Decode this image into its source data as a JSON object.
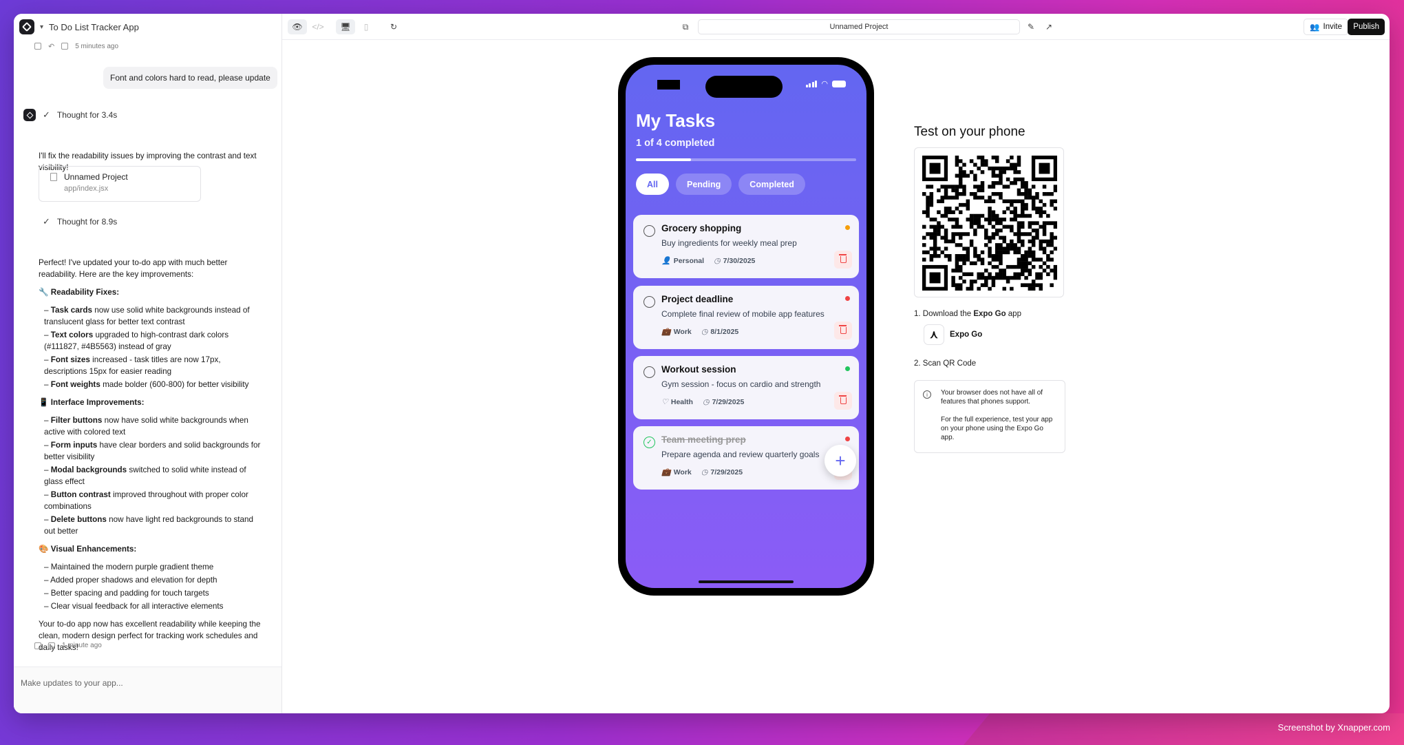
{
  "app": {
    "title": "To Do List Tracker App"
  },
  "chat": {
    "earlier_timestamp": "5 minutes ago",
    "user_message": "Font and colors hard to read, please update",
    "thought1": "Thought for 3.4s",
    "intro": "I'll fix the readability issues by improving the contrast and text visibility!",
    "file_card": {
      "name": "Unnamed Project",
      "path": "app/index.jsx"
    },
    "thought2": "Thought for 8.9s",
    "summary": "Perfect! I've updated your to-do app with much better readability. Here are the key improvements:",
    "sections": [
      {
        "title": "🔧 Readability Fixes:",
        "items": [
          {
            "bold": "Task cards",
            "text": " now use solid white backgrounds instead of translucent glass for better text contrast"
          },
          {
            "bold": "Text colors",
            "text": " upgraded to high-contrast dark colors (#111827, #4B5563) instead of gray"
          },
          {
            "bold": "Font sizes",
            "text": " increased - task titles are now 17px, descriptions 15px for easier reading"
          },
          {
            "bold": "Font weights",
            "text": " made bolder (600-800) for better visibility"
          }
        ]
      },
      {
        "title": "📱 Interface Improvements:",
        "items": [
          {
            "bold": "Filter buttons",
            "text": " now have solid white backgrounds when active with colored text"
          },
          {
            "bold": "Form inputs",
            "text": " have clear borders and solid backgrounds for better visibility"
          },
          {
            "bold": "Modal backgrounds",
            "text": " switched to solid white instead of glass effect"
          },
          {
            "bold": "Button contrast",
            "text": " improved throughout with proper color combinations"
          },
          {
            "bold": "Delete buttons",
            "text": " now have light red backgrounds to stand out better"
          }
        ]
      },
      {
        "title": "🎨 Visual Enhancements:",
        "items": [
          {
            "bold": "",
            "text": "Maintained the modern purple gradient theme"
          },
          {
            "bold": "",
            "text": "Added proper shadows and elevation for depth"
          },
          {
            "bold": "",
            "text": "Better spacing and padding for touch targets"
          },
          {
            "bold": "",
            "text": "Clear visual feedback for all interactive elements"
          }
        ]
      }
    ],
    "closing": "Your to-do app now has excellent readability while keeping the clean, modern design perfect for tracking work schedules and daily tasks!",
    "last_timestamp": "1 minute ago",
    "composer_placeholder": "Make updates to your app..."
  },
  "toolbar": {
    "url": "Unnamed Project",
    "invite_label": "Invite",
    "publish_label": "Publish"
  },
  "phone": {
    "title": "My Tasks",
    "subtitle": "1 of 4 completed",
    "progress_fraction": 0.25,
    "filters": [
      "All",
      "Pending",
      "Completed"
    ],
    "active_filter": "All",
    "tasks": [
      {
        "title": "Grocery shopping",
        "desc": "Buy ingredients for weekly meal prep",
        "category": "Personal",
        "category_icon": "person-icon",
        "date": "7/30/2025",
        "priority_color": "#f59e0b",
        "done": false
      },
      {
        "title": "Project deadline",
        "desc": "Complete final review of mobile app features",
        "category": "Work",
        "category_icon": "briefcase-icon",
        "date": "8/1/2025",
        "priority_color": "#ef4444",
        "done": false
      },
      {
        "title": "Workout session",
        "desc": "Gym session - focus on cardio and strength",
        "category": "Health",
        "category_icon": "heart-icon",
        "date": "7/29/2025",
        "priority_color": "#22c55e",
        "done": false
      },
      {
        "title": "Team meeting prep",
        "desc": "Prepare agenda and review quarterly goals",
        "category": "Work",
        "category_icon": "briefcase-icon",
        "date": "7/29/2025",
        "priority_color": "#ef4444",
        "done": true
      }
    ]
  },
  "test_panel": {
    "title": "Test on your phone",
    "step1_prefix": "1. Download the ",
    "step1_bold": "Expo Go",
    "step1_suffix": " app",
    "expo_label": "Expo Go",
    "step2": "2. Scan QR Code",
    "notice_line1": "Your browser does not have all of features that phones support.",
    "notice_line2": "For the full experience, test your app on your phone using the Expo Go app."
  },
  "footer": {
    "credit": "Screenshot by Xnapper.com"
  },
  "colors": {
    "accent": "#6366f1",
    "accent2": "#8b5cf6",
    "publish_bg": "#111111"
  }
}
